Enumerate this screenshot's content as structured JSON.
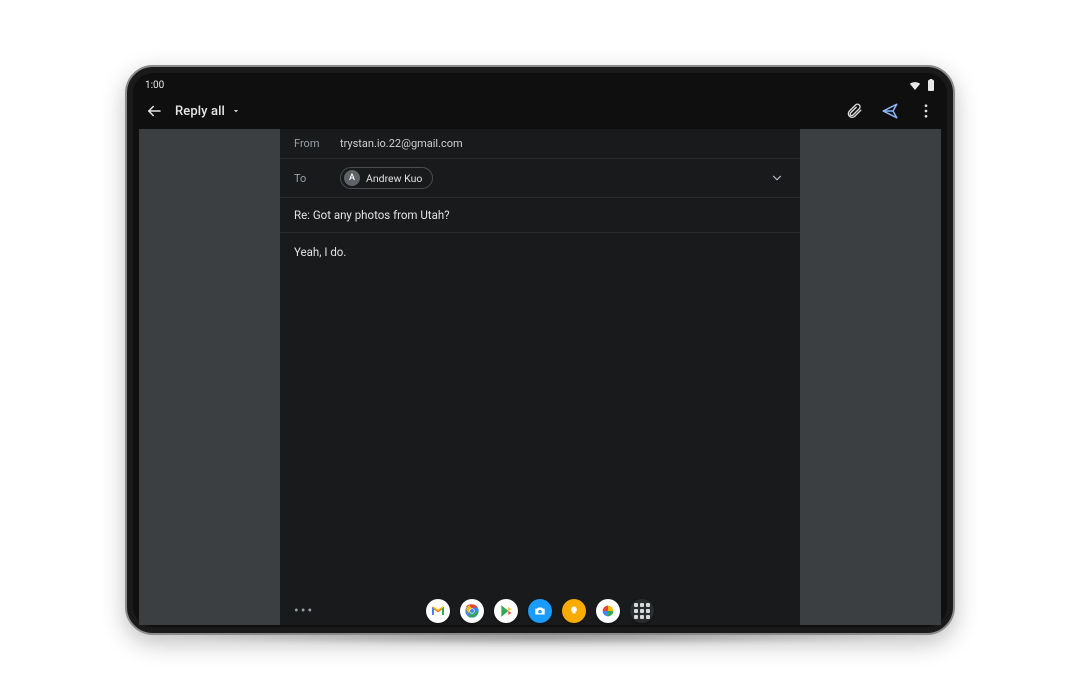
{
  "status": {
    "time": "1:00"
  },
  "appbar": {
    "title": "Reply all"
  },
  "compose": {
    "from_label": "From",
    "from_value": "trystan.io.22@gmail.com",
    "to_label": "To",
    "to_chip_initial": "A",
    "to_chip_name": "Andrew Kuo",
    "subject": "Re: Got any photos from Utah?",
    "body": "Yeah, I do.",
    "quoted_toggle": "•••"
  }
}
